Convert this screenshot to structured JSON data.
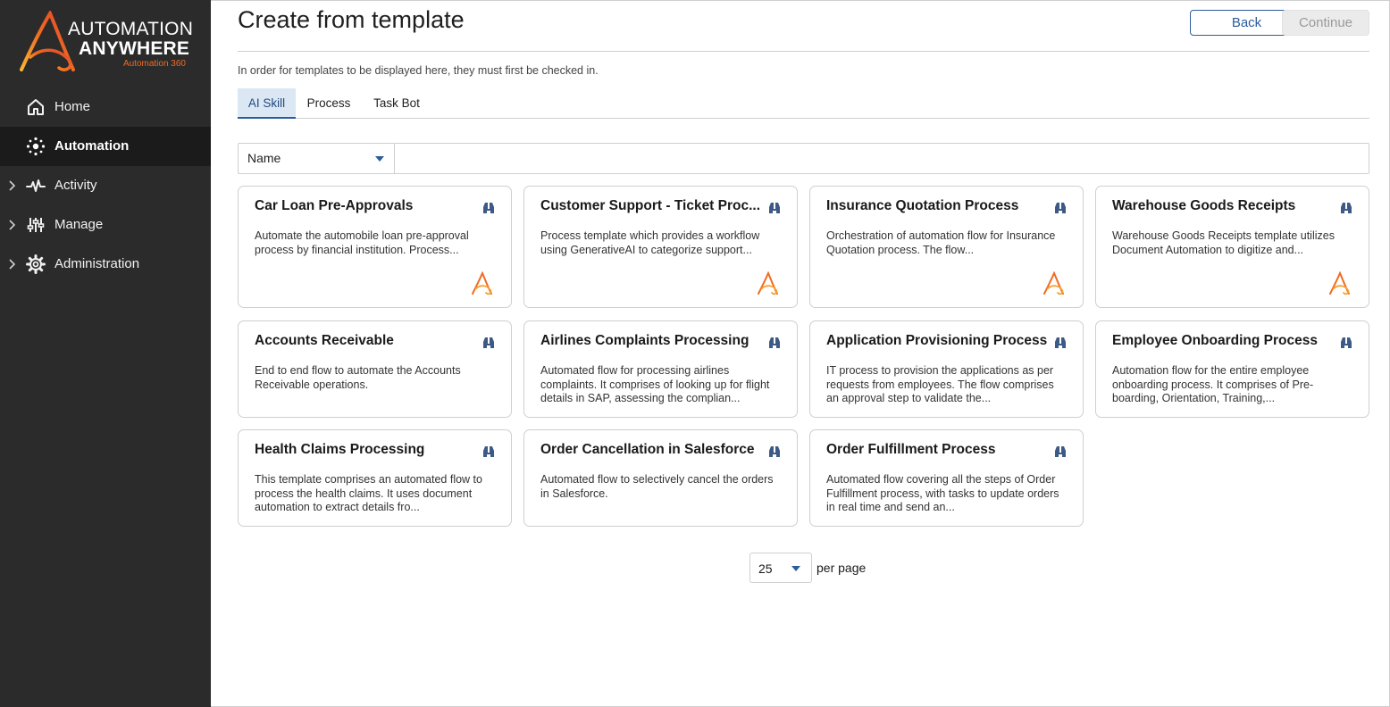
{
  "brand": {
    "line1": "AUTOMATION",
    "line2": "ANYWHERE",
    "line3": "Automation 360",
    "accent": "#f26a21"
  },
  "sidebar": {
    "items": [
      {
        "label": "Home",
        "icon": "home-icon",
        "expandable": false,
        "active": false
      },
      {
        "label": "Automation",
        "icon": "automation-icon",
        "expandable": false,
        "active": true
      },
      {
        "label": "Activity",
        "icon": "activity-icon",
        "expandable": true,
        "active": false
      },
      {
        "label": "Manage",
        "icon": "manage-icon",
        "expandable": true,
        "active": false
      },
      {
        "label": "Administration",
        "icon": "gear-icon",
        "expandable": true,
        "active": false
      }
    ]
  },
  "header": {
    "title": "Create from template",
    "back_label": "Back",
    "continue_label": "Continue",
    "info": "In order for templates to be displayed here, they must first be checked in."
  },
  "tabs": [
    {
      "label": "AI Skill",
      "active": true
    },
    {
      "label": "Process",
      "active": false
    },
    {
      "label": "Task Bot",
      "active": false
    }
  ],
  "filter": {
    "field": "Name",
    "value": ""
  },
  "cards": [
    {
      "title": "Car Loan Pre-Approvals",
      "desc": "Automate the automobile loan pre-approval process by financial institution. Process...",
      "has_logo": true
    },
    {
      "title": "Customer Support - Ticket Proc...",
      "desc": "Process template which provides a workflow using GenerativeAI to categorize support...",
      "has_logo": true
    },
    {
      "title": "Insurance Quotation Process",
      "desc": "Orchestration of automation flow for Insurance Quotation process. The flow...",
      "has_logo": true
    },
    {
      "title": "Warehouse Goods Receipts",
      "desc": "Warehouse Goods Receipts template utilizes Document Automation to digitize and...",
      "has_logo": true
    },
    {
      "title": "Accounts Receivable",
      "desc": "End to end flow to automate the Accounts Receivable operations.",
      "has_logo": false
    },
    {
      "title": "Airlines Complaints Processing",
      "desc": "Automated flow for processing airlines complaints. It comprises of looking up for flight details in SAP, assessing the complian...",
      "has_logo": false
    },
    {
      "title": "Application Provisioning Process",
      "desc": "IT process to provision the applications as per requests from employees. The flow comprises an approval step to validate the...",
      "has_logo": false
    },
    {
      "title": "Employee Onboarding Process",
      "desc": "Automation flow for the entire employee onboarding process. It comprises of Pre-boarding, Orientation, Training,...",
      "has_logo": false
    },
    {
      "title": "Health Claims Processing",
      "desc": "This template comprises an automated flow to process the health claims. It uses document automation to extract details fro...",
      "has_logo": false
    },
    {
      "title": "Order Cancellation in Salesforce",
      "desc": "Automated flow to selectively cancel the orders in Salesforce.",
      "has_logo": false
    },
    {
      "title": "Order Fulfillment Process",
      "desc": "Automated flow covering all the steps of Order Fulfillment process, with tasks to update orders in real time and send an...",
      "has_logo": false
    }
  ],
  "pagination": {
    "per_page": "25",
    "label": "per page"
  },
  "colors": {
    "sidebar_bg": "#2b2b2b",
    "primary": "#2b5d9c",
    "tab_active_bg": "#dbe7f3"
  }
}
